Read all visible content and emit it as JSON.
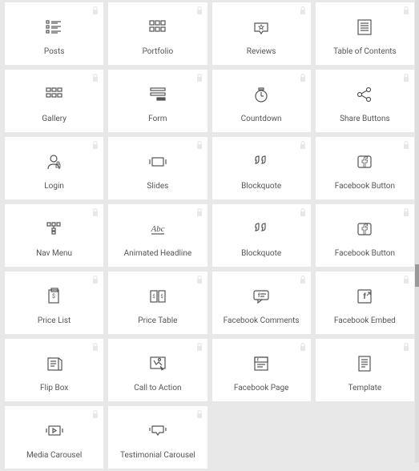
{
  "widgets": [
    {
      "id": "posts",
      "label": "Posts",
      "icon": "posts"
    },
    {
      "id": "portfolio",
      "label": "Portfolio",
      "icon": "portfolio"
    },
    {
      "id": "reviews",
      "label": "Reviews",
      "icon": "reviews"
    },
    {
      "id": "table-of-contents",
      "label": "Table of Contents",
      "icon": "toc"
    },
    {
      "id": "gallery",
      "label": "Gallery",
      "icon": "gallery"
    },
    {
      "id": "form",
      "label": "Form",
      "icon": "form"
    },
    {
      "id": "countdown",
      "label": "Countdown",
      "icon": "countdown"
    },
    {
      "id": "share-buttons",
      "label": "Share Buttons",
      "icon": "share"
    },
    {
      "id": "login",
      "label": "Login",
      "icon": "login"
    },
    {
      "id": "slides",
      "label": "Slides",
      "icon": "slides"
    },
    {
      "id": "blockquote",
      "label": "Blockquote",
      "icon": "blockquote"
    },
    {
      "id": "facebook-button",
      "label": "Facebook Button",
      "icon": "fb-button"
    },
    {
      "id": "nav-menu",
      "label": "Nav Menu",
      "icon": "nav-menu"
    },
    {
      "id": "animated-headline",
      "label": "Animated Headline",
      "icon": "animated-headline"
    },
    {
      "id": "blockquote-2",
      "label": "Blockquote",
      "icon": "blockquote"
    },
    {
      "id": "facebook-button-2",
      "label": "Facebook Button",
      "icon": "fb-button"
    },
    {
      "id": "price-list",
      "label": "Price List",
      "icon": "price-list"
    },
    {
      "id": "price-table",
      "label": "Price Table",
      "icon": "price-table"
    },
    {
      "id": "facebook-comments",
      "label": "Facebook Comments",
      "icon": "fb-comments"
    },
    {
      "id": "facebook-embed",
      "label": "Facebook Embed",
      "icon": "fb-embed"
    },
    {
      "id": "flip-box",
      "label": "Flip Box",
      "icon": "flip-box"
    },
    {
      "id": "call-to-action",
      "label": "Call to Action",
      "icon": "cta"
    },
    {
      "id": "facebook-page",
      "label": "Facebook Page",
      "icon": "fb-page"
    },
    {
      "id": "template",
      "label": "Template",
      "icon": "template"
    },
    {
      "id": "media-carousel",
      "label": "Media Carousel",
      "icon": "media-carousel"
    },
    {
      "id": "testimonial-carousel",
      "label": "Testimonial Carousel",
      "icon": "testimonial-carousel"
    }
  ]
}
